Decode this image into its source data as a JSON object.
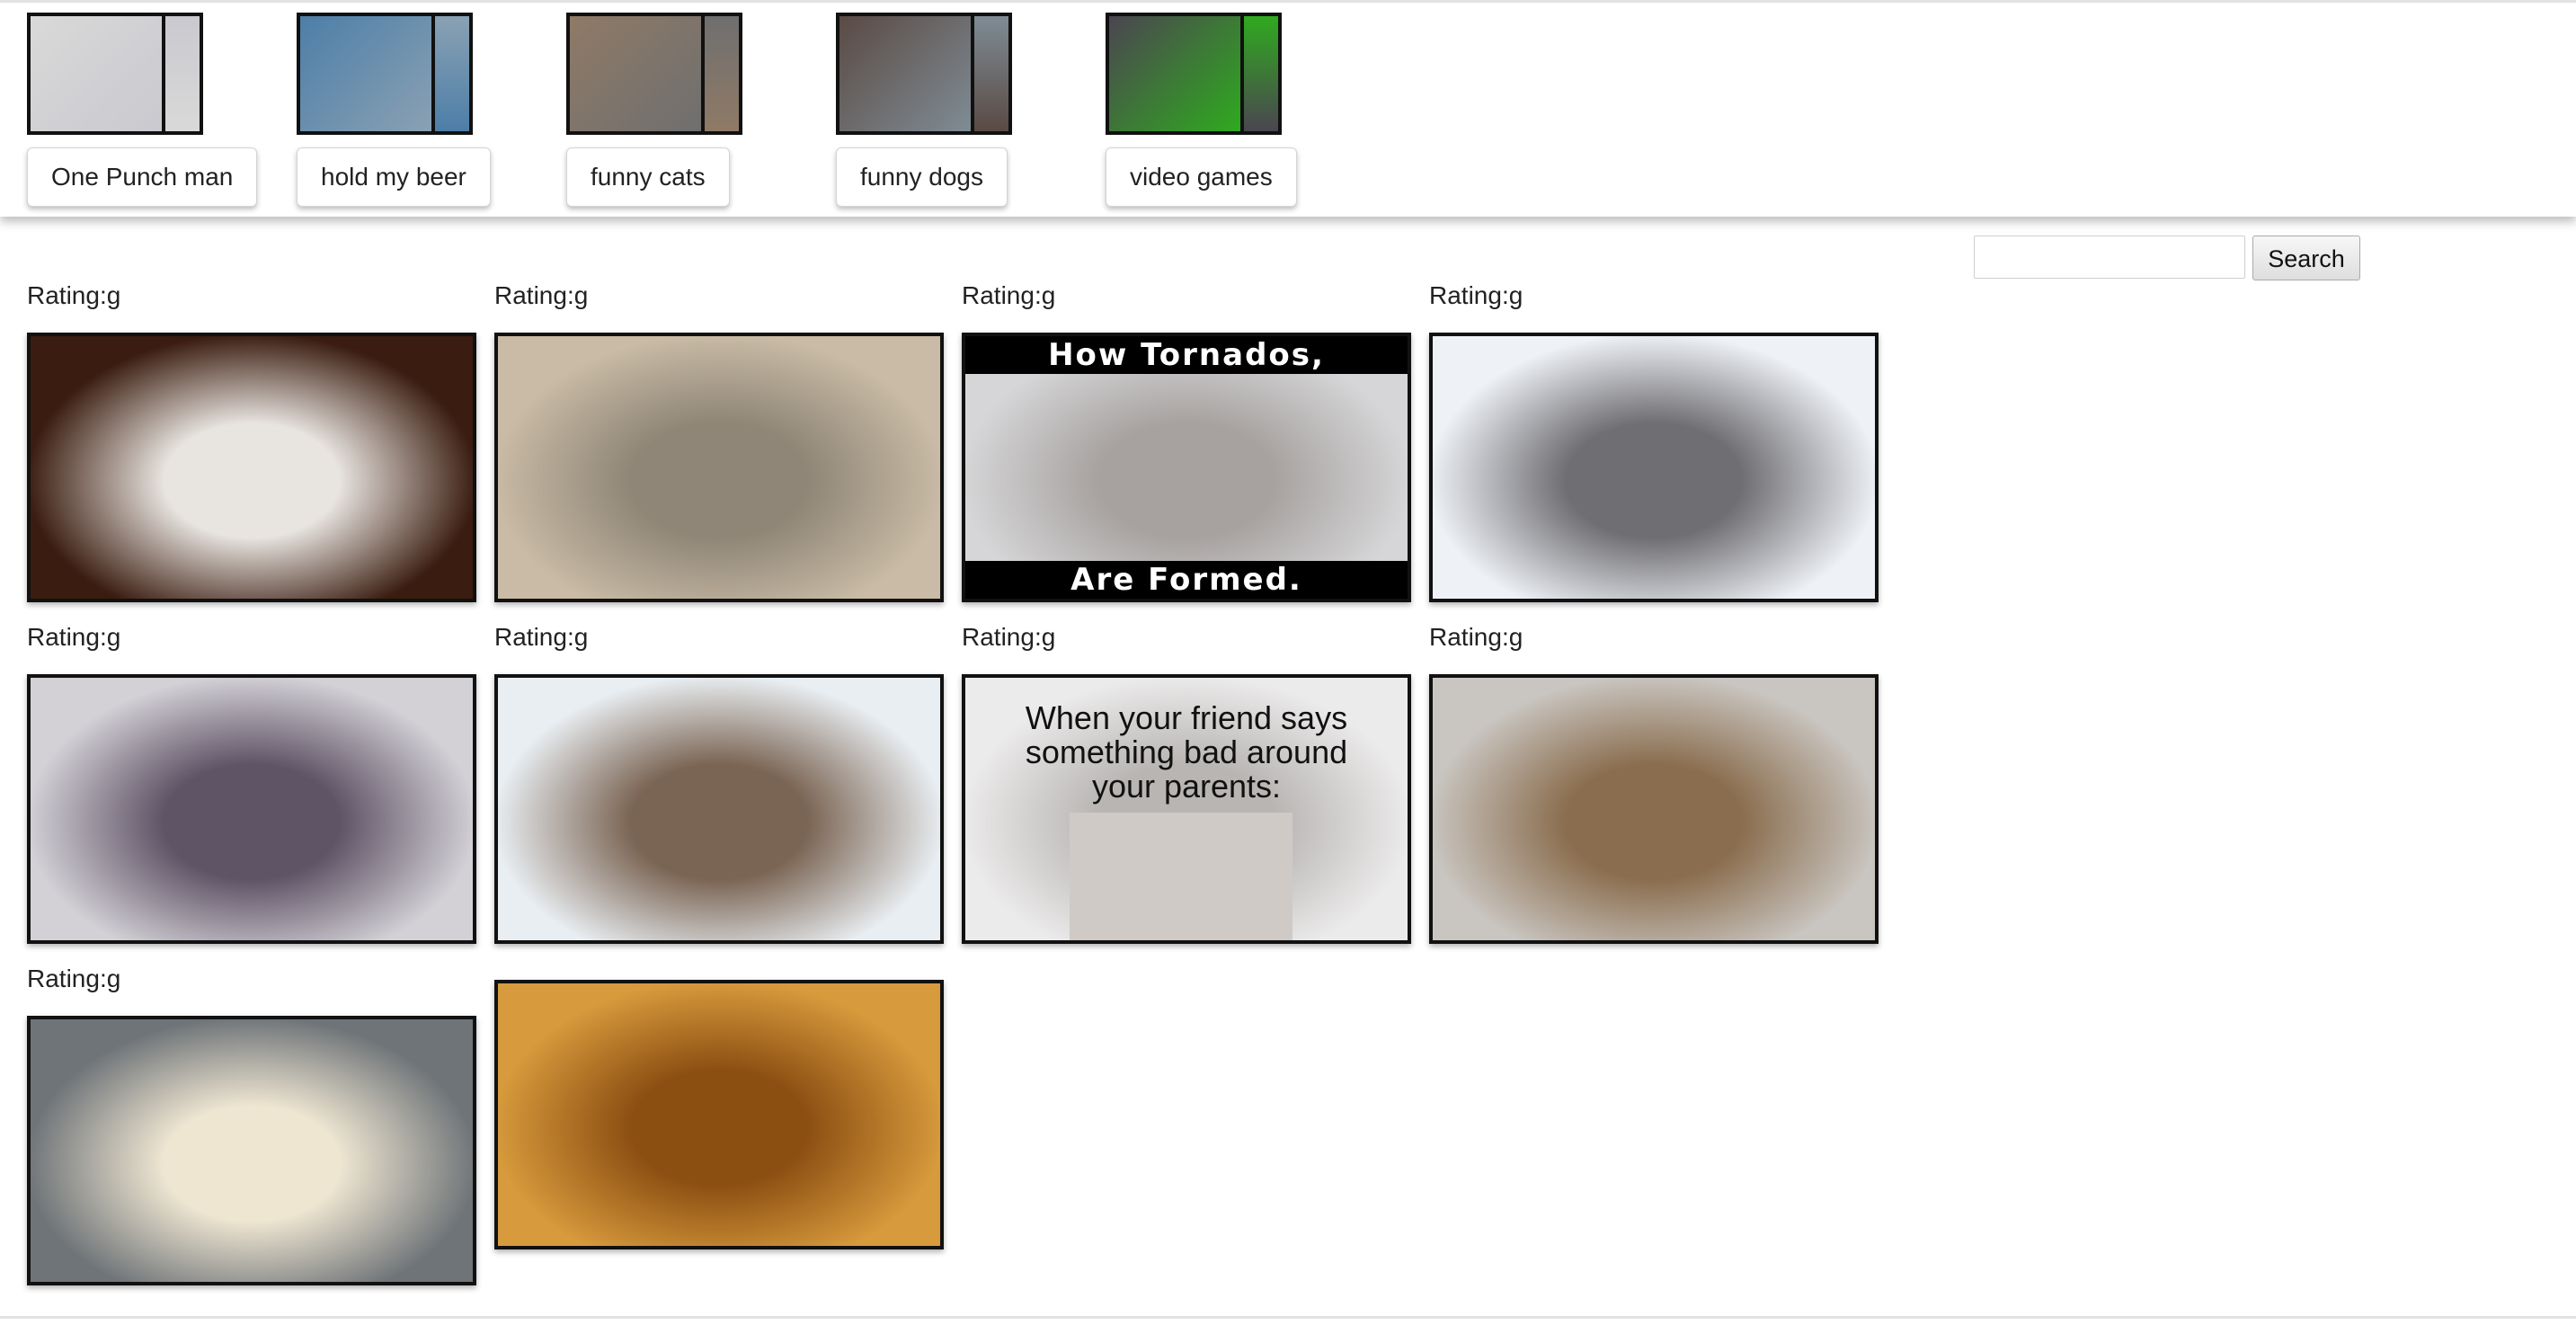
{
  "topics": [
    {
      "label": "One Punch man",
      "thumb_colors": [
        "#d9d9d9",
        "#c9c9cf"
      ]
    },
    {
      "label": "hold my beer",
      "thumb_colors": [
        "#4d7ea8",
        "#8aa1b3"
      ]
    },
    {
      "label": "funny cats",
      "thumb_colors": [
        "#8f7a66",
        "#6f6f6f"
      ]
    },
    {
      "label": "funny dogs",
      "thumb_colors": [
        "#5a4a44",
        "#7f8c95"
      ]
    },
    {
      "label": "video games",
      "thumb_colors": [
        "#4b4550",
        "#2faa1f"
      ]
    }
  ],
  "search": {
    "button_label": "Search",
    "placeholder": ""
  },
  "gifs": [
    {
      "rating": "Rating:g",
      "colors": [
        "#3a1c10",
        "#e8e4df"
      ]
    },
    {
      "rating": "Rating:g",
      "colors": [
        "#c9bba5",
        "#8f8677"
      ]
    },
    {
      "rating": "Rating:g",
      "colors": [
        "#d6d6d8",
        "#a7a2a0"
      ],
      "top_text": "How Tornados,",
      "bottom_text": "Are Formed."
    },
    {
      "rating": "Rating:g",
      "colors": [
        "#eef1f6",
        "#6f6e72"
      ]
    },
    {
      "rating": "Rating:g",
      "colors": [
        "#d3d1d6",
        "#5f5366"
      ]
    },
    {
      "rating": "Rating:g",
      "colors": [
        "#e9eef2",
        "#7a6453"
      ]
    },
    {
      "rating": "Rating:g",
      "colors": [
        "#ecebeb",
        "#b8b5b3"
      ],
      "caption": "When your friend says something bad around your parents:"
    },
    {
      "rating": "Rating:g",
      "colors": [
        "#c9c5c0",
        "#8a6d4e"
      ]
    },
    {
      "rating": "Rating:g",
      "colors": [
        "#6f7478",
        "#efe6d2"
      ]
    },
    {
      "rating": "",
      "colors": [
        "#d79a3c",
        "#8c4f12"
      ]
    }
  ]
}
